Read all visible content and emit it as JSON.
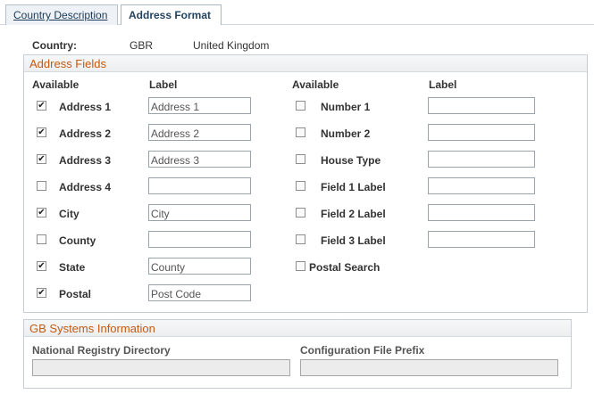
{
  "tabs": [
    {
      "label": "Country Description",
      "active": false
    },
    {
      "label": "Address Format",
      "active": true
    }
  ],
  "country": {
    "label": "Country:",
    "code": "GBR",
    "name": "United Kingdom"
  },
  "address_fields": {
    "title": "Address Fields",
    "col_available": "Available",
    "col_label": "Label",
    "left": [
      {
        "name": "Address 1",
        "checked": true,
        "label": "Address 1"
      },
      {
        "name": "Address 2",
        "checked": true,
        "label": "Address 2"
      },
      {
        "name": "Address 3",
        "checked": true,
        "label": "Address 3"
      },
      {
        "name": "Address 4",
        "checked": false,
        "label": ""
      },
      {
        "name": "City",
        "checked": true,
        "label": "City"
      },
      {
        "name": "County",
        "checked": false,
        "label": ""
      },
      {
        "name": "State",
        "checked": true,
        "label": "County"
      },
      {
        "name": "Postal",
        "checked": true,
        "label": "Post Code"
      }
    ],
    "right": [
      {
        "name": "Number 1",
        "checked": false,
        "label": ""
      },
      {
        "name": "Number 2",
        "checked": false,
        "label": ""
      },
      {
        "name": "House Type",
        "checked": false,
        "label": ""
      },
      {
        "name": "Field 1 Label",
        "checked": false,
        "label": ""
      },
      {
        "name": "Field 2 Label",
        "checked": false,
        "label": ""
      },
      {
        "name": "Field 3 Label",
        "checked": false,
        "label": ""
      }
    ],
    "postal_search": {
      "name": "Postal Search",
      "checked": false
    }
  },
  "systems_info": {
    "title": "GB Systems Information",
    "national_registry_label": "National Registry Directory",
    "national_registry_value": "",
    "config_prefix_label": "Configuration File Prefix",
    "config_prefix_value": ""
  },
  "colors": {
    "group_title": "#c55a11",
    "tab_text": "#1b3a57"
  }
}
